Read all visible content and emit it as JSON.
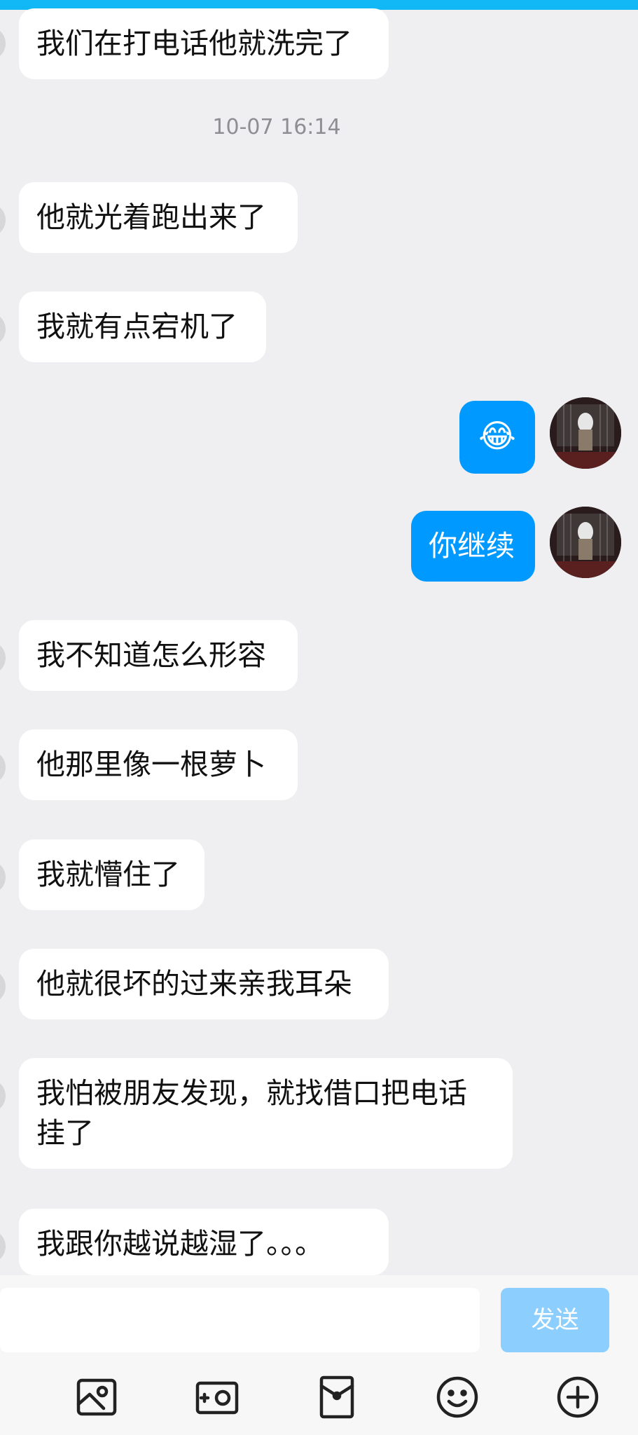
{
  "messages": [
    {
      "side": "in",
      "text": "我们在打电话他就洗完了"
    },
    {
      "type": "timestamp",
      "text": "10-07 16:14"
    },
    {
      "side": "in",
      "text": "他就光着跑出来了"
    },
    {
      "side": "in",
      "text": "我就有点宕机了"
    },
    {
      "side": "out",
      "text": "😂"
    },
    {
      "side": "out",
      "text": "你继续"
    },
    {
      "side": "in",
      "text": "我不知道怎么形容"
    },
    {
      "side": "in",
      "text": "他那里像一根萝卜"
    },
    {
      "side": "in",
      "text": "我就懵住了"
    },
    {
      "side": "in",
      "text": "他就很坏的过来亲我耳朵"
    },
    {
      "side": "in",
      "text_line1": "我怕被朋友发现，就找借口把电话",
      "text_line2": "挂了"
    },
    {
      "side": "in",
      "text": "我跟你越说越湿了。。。"
    }
  ],
  "composer": {
    "input_value": "",
    "placeholder": "",
    "send_label": "发送"
  },
  "toolbar": {
    "icons": [
      "image-icon",
      "camera-icon",
      "red-packet-icon",
      "emoji-icon",
      "plus-icon"
    ]
  },
  "colors": {
    "accent": "#12b7f5",
    "outgoing_bubble": "#0099ff",
    "incoming_bubble": "#ffffff",
    "background": "#efeff1",
    "send_disabled": "#8ccfff"
  }
}
